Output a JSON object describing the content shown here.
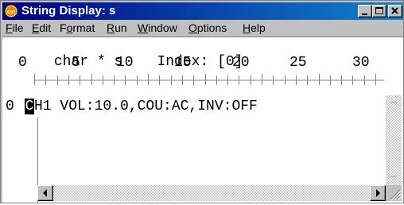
{
  "window": {
    "title": "String Display: s",
    "icon": "cvi-app-icon",
    "controls": [
      "minimize-icon",
      "maximize-icon",
      "close-icon"
    ]
  },
  "menu": {
    "items": [
      {
        "label": "File",
        "mnemonic_index": 0
      },
      {
        "label": "Edit",
        "mnemonic_index": 0
      },
      {
        "label": "Format",
        "mnemonic_index": 1
      },
      {
        "label": "Run",
        "mnemonic_index": 0
      },
      {
        "label": "Window",
        "mnemonic_index": 0
      },
      {
        "label": "Options",
        "mnemonic_index": 0
      },
      {
        "label": "Help",
        "mnemonic_index": 0
      }
    ]
  },
  "display": {
    "declaration": "char * s",
    "index_label": "Index:",
    "index_value": "[0]",
    "ruler_labels": [
      "0",
      "5",
      "10",
      "15",
      "20",
      "25",
      "30"
    ],
    "row_index": "0",
    "cursor_char": "C",
    "string_rest": "H1 VOL:10.0,COU:AC,INV:OFF"
  },
  "colors": {
    "titlebar_start": "#000080",
    "titlebar_end": "#1084d0",
    "chrome": "#c0c0c0"
  }
}
